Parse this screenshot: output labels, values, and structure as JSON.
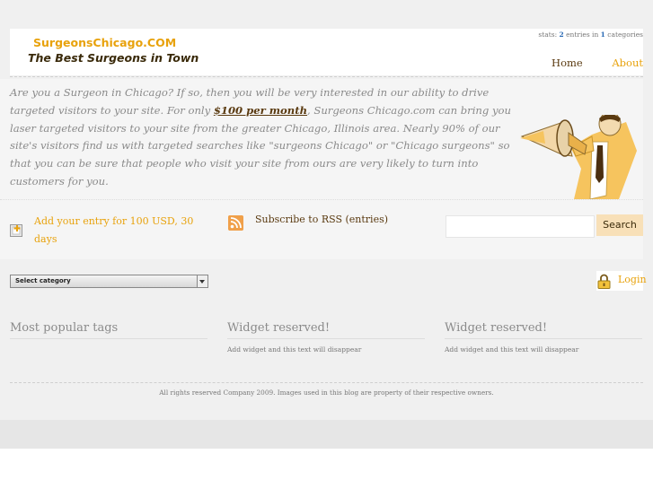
{
  "header": {
    "logo_line1": "SurgeonsChicago.COM",
    "logo_line2": "The Best Surgeons in Town",
    "stats_prefix": "stats:",
    "stats_entries": "2",
    "stats_mid": "entries in",
    "stats_categories": "1",
    "stats_suffix": "categories"
  },
  "nav": {
    "home": "Home",
    "about": "About"
  },
  "intro": {
    "text_before": "Are you a Surgeon in Chicago? If so, then you will be very interested in our ability to drive targeted visitors to your site. For only ",
    "price_link": "$100 per month",
    "text_after": ", Surgeons Chicago.com can bring you laser targeted visitors to your site from the greater Chicago, Illinois area. Nearly 90% of our site's visitors find us with targeted searches like \"surgeons Chicago\" or \"Chicago surgeons\" so that you can be sure that people who visit your site from ours are very likely to turn into customers for you."
  },
  "actions": {
    "add_entry": "Add your entry for 100 USD, 30 days",
    "subscribe": "Subscribe to RSS (entries)",
    "search_placeholder": "",
    "search_button": "Search"
  },
  "category_select": {
    "selected": "Select category"
  },
  "login": {
    "label": "Login"
  },
  "widgets": [
    {
      "title": "Most popular tags",
      "text": ""
    },
    {
      "title": "Widget reserved!",
      "text": "Add widget and this text will disappear"
    },
    {
      "title": "Widget reserved!",
      "text": "Add widget and this text will disappear"
    }
  ],
  "footer": {
    "text": "All rights reserved Company 2009. Images used in this blog are property of their respective owners."
  },
  "colors": {
    "accent": "#e8a20c",
    "brown": "#5a3a10",
    "stats_blue": "#2a6ab5"
  },
  "icons": {
    "add": "add-entry-icon",
    "rss": "rss-icon",
    "lock": "lock-icon",
    "illustration": "man-with-megaphone"
  }
}
